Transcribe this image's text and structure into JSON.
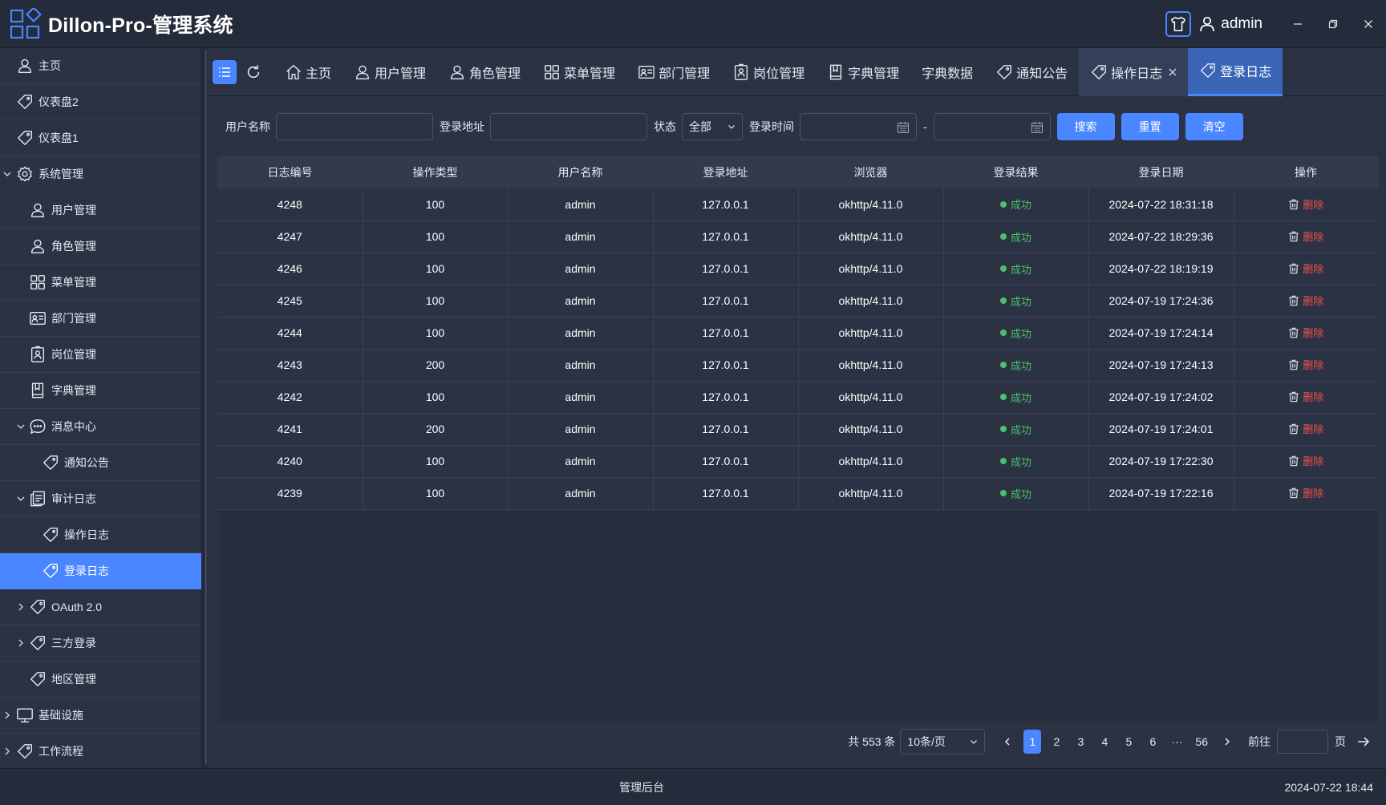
{
  "app": {
    "title": "Dillon-Pro-管理系统",
    "user": "admin"
  },
  "sidebar": {
    "items": [
      {
        "label": "主页",
        "icon": "user-icon",
        "level": 0
      },
      {
        "label": "仪表盘2",
        "icon": "tag-icon",
        "level": 0
      },
      {
        "label": "仪表盘1",
        "icon": "tag-icon",
        "level": 0
      },
      {
        "label": "系统管理",
        "icon": "gear-icon",
        "level": 0,
        "chevron": "down"
      },
      {
        "label": "用户管理",
        "icon": "user-icon",
        "level": 1
      },
      {
        "label": "角色管理",
        "icon": "user-icon",
        "level": 1
      },
      {
        "label": "菜单管理",
        "icon": "grid-icon",
        "level": 1
      },
      {
        "label": "部门管理",
        "icon": "id-card-icon",
        "level": 1
      },
      {
        "label": "岗位管理",
        "icon": "badge-icon",
        "level": 1
      },
      {
        "label": "字典管理",
        "icon": "book-icon",
        "level": 1
      },
      {
        "label": "消息中心",
        "icon": "chat-icon",
        "level": 1,
        "chevron": "down"
      },
      {
        "label": "通知公告",
        "icon": "tag-icon",
        "level": 2
      },
      {
        "label": "审计日志",
        "icon": "document-icon",
        "level": 1,
        "chevron": "down"
      },
      {
        "label": "操作日志",
        "icon": "tag-icon",
        "level": 2
      },
      {
        "label": "登录日志",
        "icon": "tag-icon",
        "level": 2,
        "active": true
      },
      {
        "label": "OAuth 2.0",
        "icon": "tag-icon",
        "level": 1,
        "chevron": "right"
      },
      {
        "label": "三方登录",
        "icon": "tag-icon",
        "level": 1,
        "chevron": "right"
      },
      {
        "label": "地区管理",
        "icon": "tag-icon",
        "level": 1
      },
      {
        "label": "基础设施",
        "icon": "monitor-icon",
        "level": 0,
        "chevron": "right"
      },
      {
        "label": "工作流程",
        "icon": "tag-icon",
        "level": 0,
        "chevron": "right"
      }
    ]
  },
  "tabs": [
    {
      "label": "主页",
      "icon": "home-icon"
    },
    {
      "label": "用户管理",
      "icon": "user-icon"
    },
    {
      "label": "角色管理",
      "icon": "user-icon"
    },
    {
      "label": "菜单管理",
      "icon": "grid-icon"
    },
    {
      "label": "部门管理",
      "icon": "id-card-icon"
    },
    {
      "label": "岗位管理",
      "icon": "badge-icon"
    },
    {
      "label": "字典管理",
      "icon": "book-icon"
    },
    {
      "label": "字典数据",
      "icon": ""
    },
    {
      "label": "通知公告",
      "icon": "tag-icon"
    },
    {
      "label": "操作日志",
      "icon": "tag-icon",
      "closable": true,
      "state": "visited"
    },
    {
      "label": "登录日志",
      "icon": "tag-icon",
      "state": "active"
    }
  ],
  "filters": {
    "username_label": "用户名称",
    "username_value": "",
    "address_label": "登录地址",
    "address_value": "",
    "status_label": "状态",
    "status_value": "全部",
    "time_label": "登录时间",
    "time_sep": "-",
    "search_btn": "搜索",
    "reset_btn": "重置",
    "clear_btn": "清空"
  },
  "table": {
    "columns": [
      "日志编号",
      "操作类型",
      "用户名称",
      "登录地址",
      "浏览器",
      "登录结果",
      "登录日期",
      "操作"
    ],
    "delete_label": "删除",
    "rows": [
      {
        "id": "4248",
        "type": "100",
        "user": "admin",
        "ip": "127.0.0.1",
        "browser": "okhttp/4.11.0",
        "result": "成功",
        "date": "2024-07-22 18:31:18"
      },
      {
        "id": "4247",
        "type": "100",
        "user": "admin",
        "ip": "127.0.0.1",
        "browser": "okhttp/4.11.0",
        "result": "成功",
        "date": "2024-07-22 18:29:36"
      },
      {
        "id": "4246",
        "type": "100",
        "user": "admin",
        "ip": "127.0.0.1",
        "browser": "okhttp/4.11.0",
        "result": "成功",
        "date": "2024-07-22 18:19:19"
      },
      {
        "id": "4245",
        "type": "100",
        "user": "admin",
        "ip": "127.0.0.1",
        "browser": "okhttp/4.11.0",
        "result": "成功",
        "date": "2024-07-19 17:24:36"
      },
      {
        "id": "4244",
        "type": "100",
        "user": "admin",
        "ip": "127.0.0.1",
        "browser": "okhttp/4.11.0",
        "result": "成功",
        "date": "2024-07-19 17:24:14"
      },
      {
        "id": "4243",
        "type": "200",
        "user": "admin",
        "ip": "127.0.0.1",
        "browser": "okhttp/4.11.0",
        "result": "成功",
        "date": "2024-07-19 17:24:13"
      },
      {
        "id": "4242",
        "type": "100",
        "user": "admin",
        "ip": "127.0.0.1",
        "browser": "okhttp/4.11.0",
        "result": "成功",
        "date": "2024-07-19 17:24:02"
      },
      {
        "id": "4241",
        "type": "200",
        "user": "admin",
        "ip": "127.0.0.1",
        "browser": "okhttp/4.11.0",
        "result": "成功",
        "date": "2024-07-19 17:24:01"
      },
      {
        "id": "4240",
        "type": "100",
        "user": "admin",
        "ip": "127.0.0.1",
        "browser": "okhttp/4.11.0",
        "result": "成功",
        "date": "2024-07-19 17:22:30"
      },
      {
        "id": "4239",
        "type": "100",
        "user": "admin",
        "ip": "127.0.0.1",
        "browser": "okhttp/4.11.0",
        "result": "成功",
        "date": "2024-07-19 17:22:16"
      }
    ]
  },
  "pagination": {
    "total": "共 553 条",
    "page_size": "10条/页",
    "pages": [
      "1",
      "2",
      "3",
      "4",
      "5",
      "6",
      "···",
      "56"
    ],
    "current": "1",
    "goto_label": "前往",
    "page_label": "页"
  },
  "footer": {
    "center": "管理后台",
    "time": "2024-07-22 18:44"
  },
  "colors": {
    "accent": "#4a86ff",
    "success": "#4ac26b",
    "danger": "#f05050",
    "bg": "#2b3244"
  }
}
